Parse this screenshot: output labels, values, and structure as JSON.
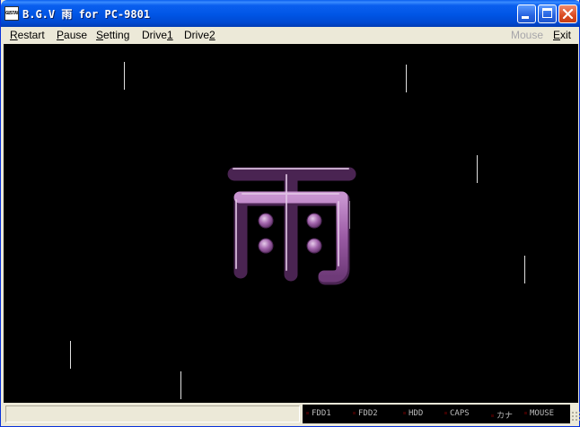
{
  "window": {
    "icon_text": "GUSTAV",
    "title": "B.G.V 雨 for PC-9801"
  },
  "menu": {
    "restart": {
      "pre": "",
      "acc": "R",
      "post": "estart"
    },
    "pause": {
      "pre": "",
      "acc": "P",
      "post": "ause"
    },
    "setting": {
      "pre": "",
      "acc": "S",
      "post": "etting"
    },
    "drive1": {
      "pre": "Drive",
      "acc": "1",
      "post": ""
    },
    "drive2": {
      "pre": "Drive",
      "acc": "2",
      "post": ""
    },
    "mouse": "Mouse",
    "exit": {
      "pre": "",
      "acc": "E",
      "post": "xit"
    }
  },
  "screen": {
    "background_color": "#000000",
    "kanji_color": "#9B5BA5",
    "kanji_highlight": "#D7B6DC",
    "kanji_shadow": "#5B2E63"
  },
  "status": {
    "indicators": [
      "FDD1",
      "FDD2",
      "HDD",
      "CAPS",
      "カナ",
      "MOUSE"
    ]
  }
}
